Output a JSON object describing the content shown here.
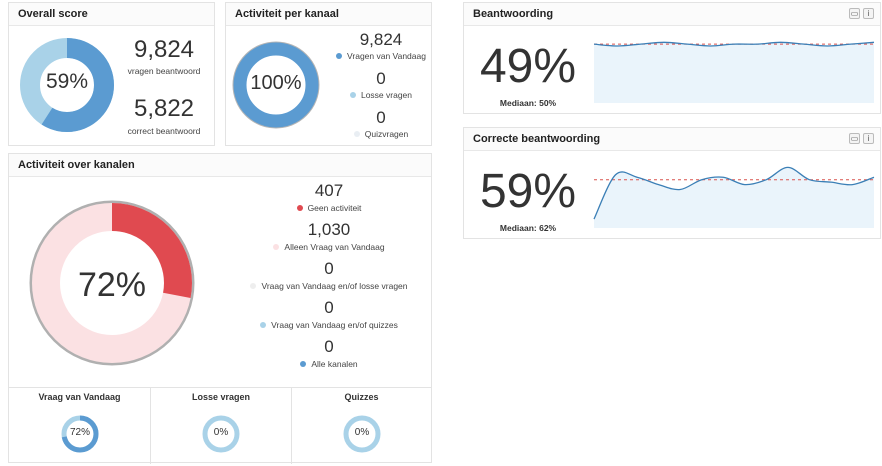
{
  "colors": {
    "blue": "#5b9bd1",
    "light_blue": "#a9d2e8",
    "red": "#e04a50",
    "pink": "#fbe1e3",
    "very_light": "#e9eef3",
    "grey_ring": "#b0b0b0",
    "spark_fill": "#eaf4fb",
    "spark_line": "#3b7fb6",
    "median_line": "#d9534f"
  },
  "overall": {
    "title": "Overall score",
    "pct_label": "59%",
    "pct": 0.59,
    "answered_value": "9,824",
    "answered_label": "vragen beantwoord",
    "correct_value": "5,822",
    "correct_label": "correct beantwoord"
  },
  "channel": {
    "title": "Activiteit per kanaal",
    "pct_label": "100%",
    "pct": 1.0,
    "items": [
      {
        "value": "9,824",
        "label": "Vragen van Vandaag",
        "color": "#5b9bd1"
      },
      {
        "value": "0",
        "label": "Losse vragen",
        "color": "#a9d2e8"
      },
      {
        "value": "0",
        "label": "Quizvragen",
        "color": "#e9eef3"
      }
    ]
  },
  "activity": {
    "title": "Activiteit over kanalen",
    "pct_label": "72%",
    "red_pct": 0.28,
    "items": [
      {
        "value": "407",
        "label": "Geen activiteit",
        "color": "#e04a50"
      },
      {
        "value": "1,030",
        "label": "Alleen Vraag van Vandaag",
        "color": "#fbe1e3"
      },
      {
        "value": "0",
        "label": "Vraag van Vandaag en/of losse vragen",
        "color": "#eeeeee"
      },
      {
        "value": "0",
        "label": "Vraag van Vandaag en/of quizzes",
        "color": "#a9d2e8"
      },
      {
        "value": "0",
        "label": "Alle kanalen",
        "color": "#5b9bd1"
      }
    ],
    "minis": [
      {
        "title": "Vraag van Vandaag",
        "pct_label": "72%",
        "pct": 0.72
      },
      {
        "title": "Losse vragen",
        "pct_label": "0%",
        "pct": 0
      },
      {
        "title": "Quizzes",
        "pct_label": "0%",
        "pct": 0
      }
    ]
  },
  "beantwoording": {
    "title": "Beantwoording",
    "pct_label": "49%",
    "median_label": "Mediaan: 50%",
    "calendar_icon": "calendar-icon",
    "info_label": "i",
    "series": [
      0.5,
      0.49,
      0.5,
      0.51,
      0.5,
      0.49,
      0.5,
      0.5,
      0.51,
      0.5,
      0.49,
      0.5,
      0.51
    ],
    "median": 0.5
  },
  "correct": {
    "title": "Correcte beantwoording",
    "pct_label": "59%",
    "median_label": "Mediaan: 62%",
    "calendar_icon": "calendar-icon",
    "info_label": "i",
    "series": [
      0.46,
      0.64,
      0.63,
      0.6,
      0.58,
      0.62,
      0.63,
      0.6,
      0.62,
      0.67,
      0.62,
      0.61,
      0.6,
      0.63
    ],
    "median": 0.62
  }
}
